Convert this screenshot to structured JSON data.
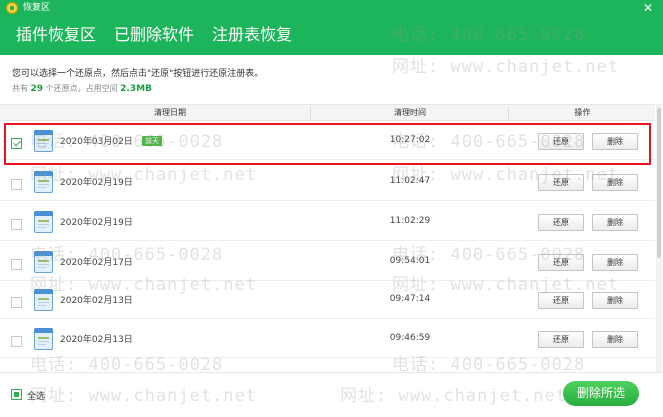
{
  "window": {
    "title": "恢复区",
    "close": "✕"
  },
  "tabs": [
    {
      "label": "插件恢复区",
      "active": false
    },
    {
      "label": "已删除软件",
      "active": false
    },
    {
      "label": "注册表恢复",
      "active": true
    }
  ],
  "info": {
    "instruction": "您可以选择一个还原点，然后点击\"还原\"按钮进行还原注册表。",
    "summary_prefix": "共有",
    "count": "29",
    "summary_middle": "个还原点，占用空间",
    "size": "2.3MB"
  },
  "table": {
    "headers": {
      "date": "清理日期",
      "time": "清理时间",
      "op": "操作"
    },
    "restore_label": "还原",
    "delete_label": "删除",
    "rows": [
      {
        "date": "2020年03月02日",
        "badge": "前天",
        "time": "10:27:02",
        "checked": true
      },
      {
        "date": "2020年02月19日",
        "badge": "",
        "time": "11:02:47",
        "checked": false
      },
      {
        "date": "2020年02月19日",
        "badge": "",
        "time": "11:02:29",
        "checked": false
      },
      {
        "date": "2020年02月17日",
        "badge": "",
        "time": "09:54:01",
        "checked": false
      },
      {
        "date": "2020年02月13日",
        "badge": "",
        "time": "09:47:14",
        "checked": false
      },
      {
        "date": "2020年02月13日",
        "badge": "",
        "time": "09:46:59",
        "checked": false
      }
    ]
  },
  "footer": {
    "select_all": "全选",
    "delete_selected": "删除所选"
  },
  "watermark": {
    "phone": "电话: 400-665-0028",
    "site": "网址: www.chanjet.net"
  },
  "colors": {
    "brand": "#1db55b",
    "highlight": "#e8141e",
    "badge": "#4fb548"
  }
}
